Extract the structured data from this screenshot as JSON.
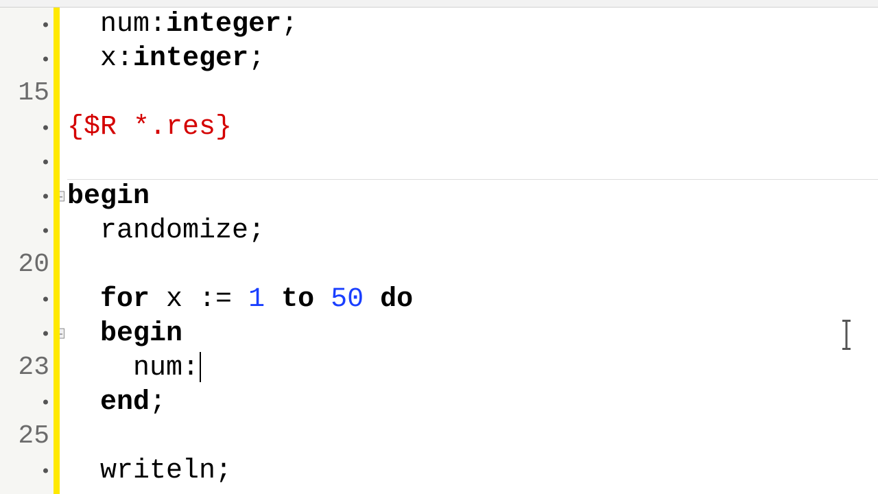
{
  "gutter": {
    "l0": ".",
    "l1": ".",
    "l2": "15",
    "l3": ".",
    "l4": ".",
    "l5": ".",
    "l6": ".",
    "l7": "20",
    "l8": ".",
    "l9": ".",
    "l10": "23",
    "l11": ".",
    "l12": "25",
    "l13": "."
  },
  "code": {
    "l0": {
      "indent": "  ",
      "a": "num",
      "b": ":",
      "c": "integer",
      "d": ";"
    },
    "l1": {
      "indent": "  ",
      "a": "x",
      "b": ":",
      "c": "integer",
      "d": ";"
    },
    "l2": {
      "text": ""
    },
    "l3": {
      "dir": "{$R *.res}"
    },
    "l4": {
      "text": ""
    },
    "l5": {
      "kw": "begin"
    },
    "l6": {
      "indent": "  ",
      "a": "randomize",
      "b": ";"
    },
    "l7": {
      "text": ""
    },
    "l8": {
      "indent": "  ",
      "kw_for": "for",
      "var": " x ",
      "assign": ":=",
      "sp1": " ",
      "n1": "1",
      "sp2": " ",
      "kw_to": "to",
      "sp3": " ",
      "n2": "50",
      "sp4": " ",
      "kw_do": "do"
    },
    "l9": {
      "indent": "  ",
      "kw": "begin"
    },
    "l10": {
      "indent": "    ",
      "a": "num",
      "b": ":"
    },
    "l11": {
      "indent": "  ",
      "kw": "end",
      "sc": ";"
    },
    "l12": {
      "text": ""
    },
    "l13": {
      "indent": "  ",
      "a": "writeln",
      "b": ";"
    }
  }
}
